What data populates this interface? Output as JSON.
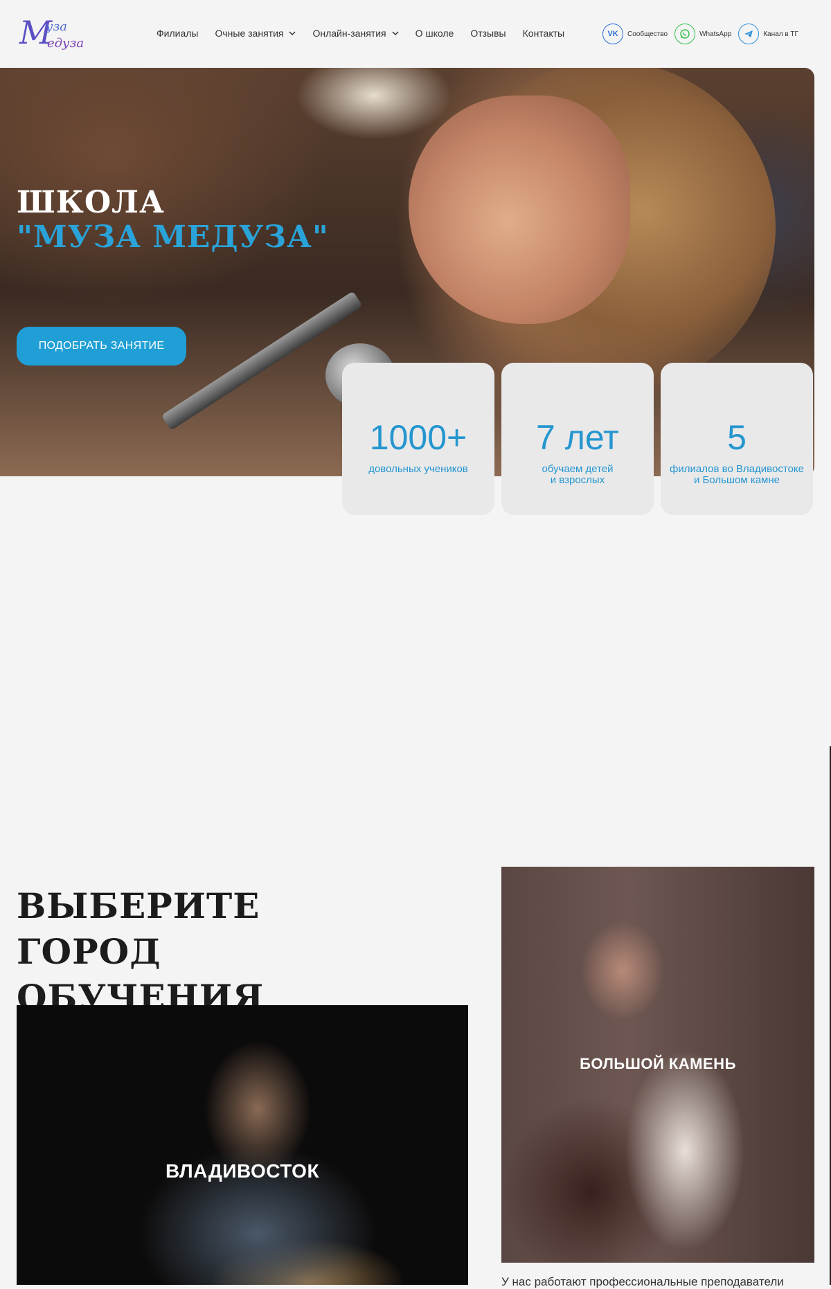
{
  "header": {
    "logo_alt": "Муза Медуза",
    "nav": [
      {
        "label": "Филиалы",
        "dropdown": false
      },
      {
        "label": "Очные занятия",
        "dropdown": true
      },
      {
        "label": "Онлайн-занятия",
        "dropdown": true
      },
      {
        "label": "О школе",
        "dropdown": false
      },
      {
        "label": "Отзывы",
        "dropdown": false
      },
      {
        "label": "Контакты",
        "dropdown": false
      }
    ],
    "socials": [
      {
        "label": "Сообщество",
        "icon": "vk-icon",
        "color": "#2a6fd6"
      },
      {
        "label": "WhatsApp",
        "icon": "whatsapp-icon",
        "color": "#35c04a"
      },
      {
        "label": "Канал в ТГ",
        "icon": "telegram-icon",
        "color": "#2f8fd8"
      }
    ]
  },
  "hero": {
    "title_line1": "ШКОЛА",
    "title_line2": "\"МУЗА МЕДУЗА\"",
    "cta": "ПОДОБРАТЬ ЗАНЯТИЕ",
    "accent_color": "#1f9fd6"
  },
  "stats": [
    {
      "value": "1000+",
      "caption": "довольных учеников"
    },
    {
      "value": "7 лет",
      "caption": "обучаем детей\nи взрослых"
    },
    {
      "value": "5",
      "caption": "филиалов во Владивостоке\nи Большом камне"
    }
  ],
  "cities": {
    "title": "ВЫБЕРИТЕ ГОРОД ОБУЧЕНИЯ",
    "items": [
      {
        "label": "ВЛАДИВОСТОК"
      },
      {
        "label": "БОЛЬШОЙ КАМЕНЬ"
      }
    ],
    "cut_text": "У нас работают профессиональные преподаватели"
  }
}
